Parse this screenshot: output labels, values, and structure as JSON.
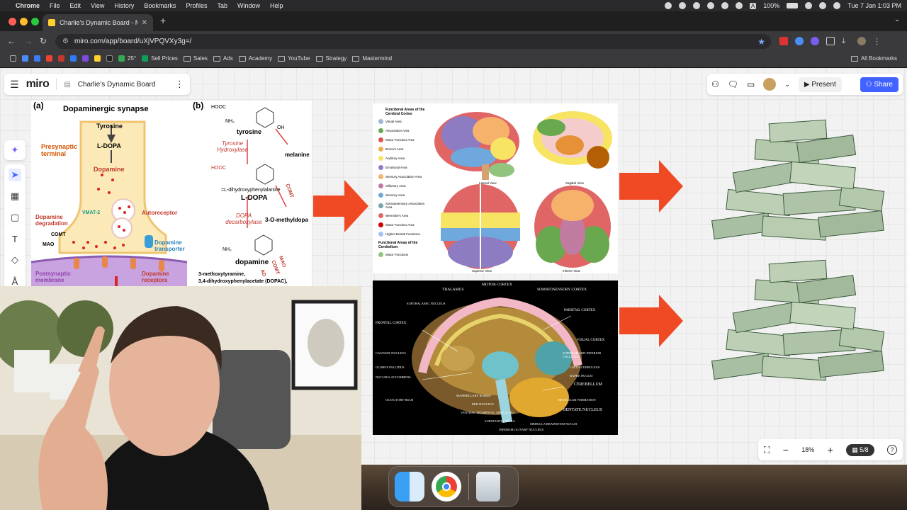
{
  "menubar": {
    "apple": "",
    "items": [
      "Chrome",
      "File",
      "Edit",
      "View",
      "History",
      "Bookmarks",
      "Profiles",
      "Tab",
      "Window",
      "Help"
    ],
    "battery": "100%",
    "datetime": "Tue 7 Jan  1:03 PM"
  },
  "browser": {
    "tab_title": "Charlie's Dynamic Board - M",
    "new_tab": "+",
    "url": "miro.com/app/board/uXjVPQVXy3g=/",
    "bookmarks": [
      {
        "label": "25°",
        "kind": "weather"
      },
      {
        "label": "Sell Prices",
        "kind": "sheet"
      },
      {
        "label": "Sales",
        "kind": "folder"
      },
      {
        "label": "Ads",
        "kind": "folder"
      },
      {
        "label": "Academy",
        "kind": "folder"
      },
      {
        "label": "YouTube",
        "kind": "folder"
      },
      {
        "label": "Strategy",
        "kind": "folder"
      },
      {
        "label": "Mastermind",
        "kind": "folder"
      }
    ],
    "all_bookmarks": "All Bookmarks",
    "accent": "#ffd02f"
  },
  "miro": {
    "logo": "miro",
    "board_name": "Charlie's Dynamic Board",
    "present_label": "Present",
    "share_label": "Share",
    "zoom": "18%",
    "page_indicator": "5/8",
    "brand_color": "#4262ff"
  },
  "diagram_synapse": {
    "panel_a": "(a)",
    "panel_b": "(b)",
    "title": "Dopaminergic synapse",
    "tyrosine": "Tyrosine",
    "ldopa": "L-DOPA",
    "dopamine": "Dopamine",
    "presynaptic": "Presynaptic terminal",
    "vmat": "VMAT-2",
    "degradation": "Dopamine degradation",
    "comt": "COMT",
    "mao": "MAO",
    "autoreceptor": "Autoreceptor",
    "transporter": "Dopamine transporter",
    "postsynaptic": "Postsynaptic membrane",
    "receptors": "Dopamine receptors",
    "b_tyrosine": "tyrosine",
    "b_hydroxylase": "Tyrosine Hydroxylase",
    "b_melanine": "melanine",
    "b_ldopa_full": "=L-dihydroxyphenylalanine",
    "b_ldopa": "L-DOPA",
    "b_decarboxylase": "DOPA decarboxylase",
    "b_methyldopa": "3-O-methyldopa",
    "b_dopamine": "dopamine",
    "b_metabolites": "3-methoxytyramine,",
    "b_dopac": "3,4-dihydroxyphenylacetate (DOPAC),",
    "b_hooc1": "HOOC",
    "b_hooc2": "HOOC",
    "b_oh": "OH",
    "b_nh2": "NH₂",
    "b_comt": "COMT",
    "b_mao": "MAO",
    "b_comt2": "COMT",
    "b_ad": "AD"
  },
  "diagram_brain_areas": {
    "title": "Functional Areas of the Cerebral Cortex",
    "legend": [
      "Visual Area",
      "Association Area",
      "Motor Function Area",
      "Broca's Area",
      "Auditory Area",
      "Emotional Area",
      "Sensory Association Area",
      "Olfactory Area",
      "Sensory Area",
      "Somatosensory Association Area",
      "Wernicke's Area",
      "Motor Function Area",
      "Higher Mental Functions"
    ],
    "cerebellum_title": "Functional Areas of the Cerebellum",
    "cerebellum_item": "Motor Functions",
    "views": [
      "Lateral View",
      "Sagittal View",
      "Superior View",
      "Inferior View"
    ]
  },
  "diagram_brain_tracts": {
    "labels": [
      "MOTOR CORTEX",
      "SOMATOSENSORY CORTEX",
      "THALAMUS",
      "SUBTHALAMIC NUCLEUS",
      "FRONTAL CORTEX",
      "PARIETAL CORTEX",
      "VISUAL CORTEX",
      "CAUDATE NUCLEUS",
      "GLOBUS PALLIDUS",
      "NUCLEUS ACCUMBENS",
      "SUPERIOR AND INFERIOR COLLICULI",
      "LOCUS COERULEUS",
      "RAPHE NUCLEI",
      "CEREBELLUM",
      "OLFACTORY BULB",
      "MAMMILLARY BODIES",
      "RED NUCLEUS",
      "VENTRAL TEGMENTAL AREA (VTA)",
      "SUBSTANTIA NIGRA",
      "RETICULAR FORMATION",
      "DENTATE NUCLEUS",
      "INFERIOR OLIVARY NUCLEUS",
      "MEDULLA BRAINSTEM NUCLEI"
    ]
  },
  "dock": {
    "apps": [
      "Finder",
      "Chrome",
      "Trash"
    ]
  },
  "colors": {
    "arrow": "#f04a24",
    "canvas_bg": "#f2f2f2"
  }
}
